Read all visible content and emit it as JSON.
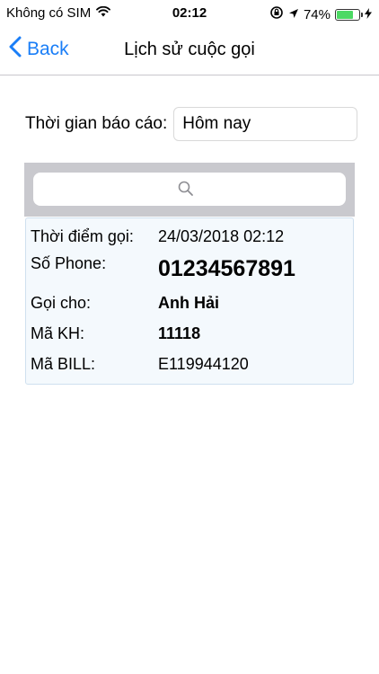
{
  "status_bar": {
    "carrier": "Không có SIM",
    "time": "02:12",
    "battery": "74%",
    "battery_level": 74,
    "icons": [
      "wifi-icon",
      "rotation-lock-icon",
      "location-arrow-icon",
      "battery-icon",
      "charging-bolt-icon"
    ]
  },
  "nav": {
    "back_label": "Back",
    "title": "Lịch sử cuộc gọi",
    "accent_color": "#1a7ef7"
  },
  "report": {
    "label": "Thời gian báo cáo:",
    "value": "Hôm nay"
  },
  "search": {
    "placeholder": "",
    "icon": "search-icon"
  },
  "record": {
    "call_time_label": "Thời điểm gọi:",
    "call_time_value": "24/03/2018 02:12",
    "phone_label": "Số Phone:",
    "phone_value": "01234567891",
    "called_label": "Gọi cho:",
    "called_value": "Anh Hải",
    "customer_label": "Mã KH:",
    "customer_value": "11118",
    "bill_label": "Mã BILL:",
    "bill_value": "E119944120"
  }
}
